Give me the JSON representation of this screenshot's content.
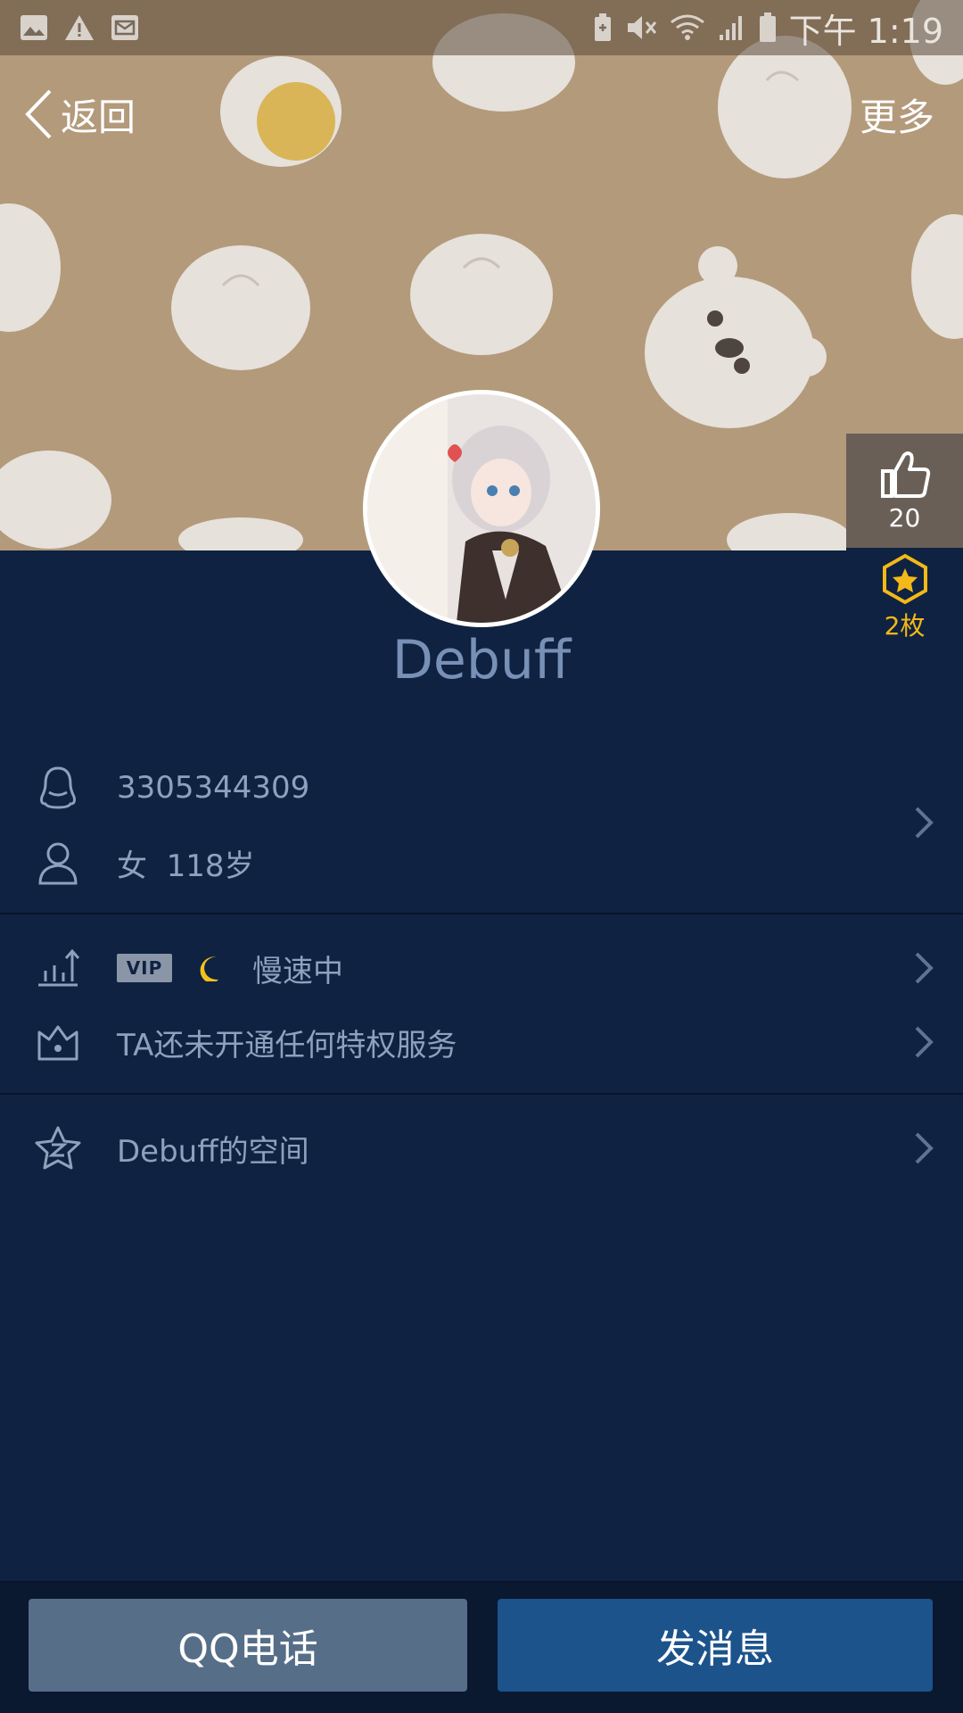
{
  "status_bar": {
    "time": "下午 1:19",
    "left_icons": [
      "image-icon",
      "warning-icon",
      "mail-icon"
    ],
    "right_icons": [
      "battery-saver-icon",
      "mute-icon",
      "wifi-icon",
      "signal-icon",
      "battery-icon"
    ]
  },
  "nav": {
    "back_label": "返回",
    "more_label": "更多"
  },
  "profile": {
    "nickname": "Debuff",
    "qq_number": "3305344309",
    "gender_age": "女  118岁"
  },
  "stats": {
    "likes": "20",
    "badges": "2枚"
  },
  "level_row": {
    "vip_tag": "VIP",
    "status": "慢速中"
  },
  "privilege_row": {
    "text": "TA还未开通任何特权服务"
  },
  "space_row": {
    "text": "Debuff的空间"
  },
  "actions": {
    "call_label": "QQ电话",
    "message_label": "发消息"
  },
  "colors": {
    "background": "#0f2241",
    "cover": "#b39a7b",
    "text_muted": "#8ea1bd",
    "nickname": "#7890b6",
    "badge_gold": "#f3b819",
    "call_button": "#566e88",
    "message_button": "#1c538b"
  }
}
